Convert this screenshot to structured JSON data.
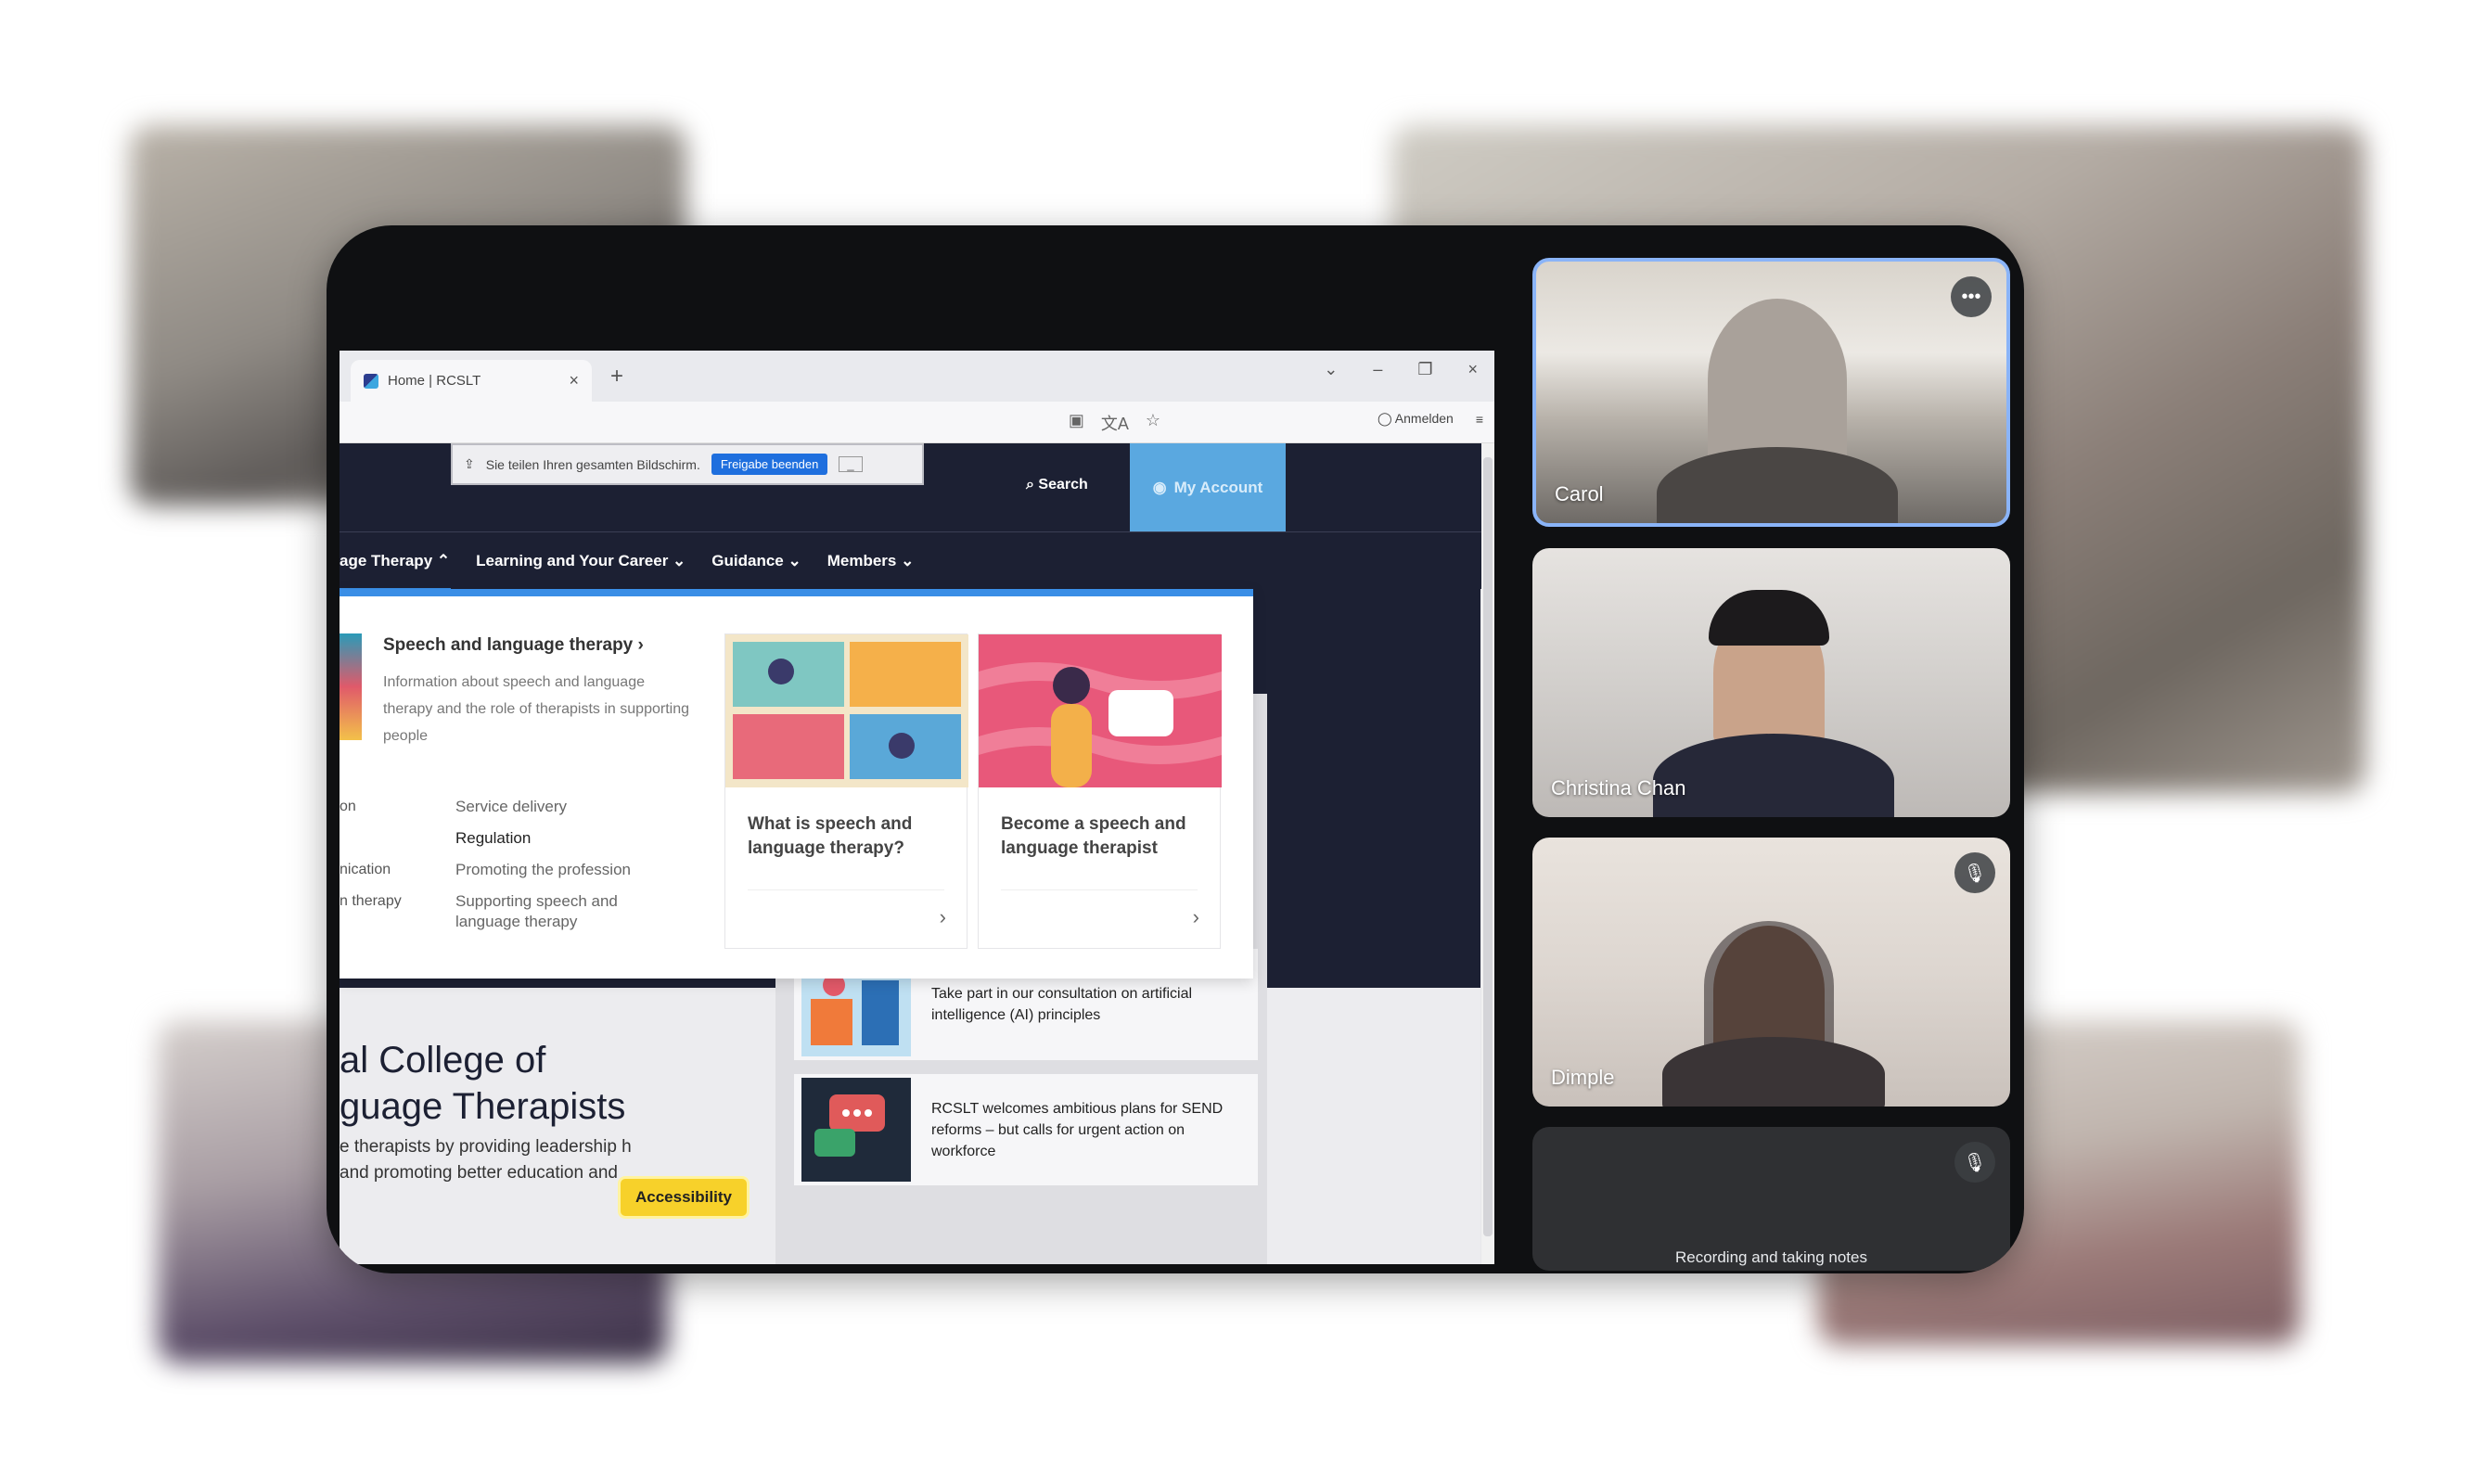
{
  "browser": {
    "tab_title": "Home | RCSLT",
    "tab_close": "×",
    "new_tab": "+",
    "window_controls": [
      "⌄",
      "–",
      "❐",
      "×"
    ],
    "toolbar_icons": [
      "▣",
      "文A",
      "☆"
    ],
    "profile_label": "Anmelden",
    "menu_icon": "≡"
  },
  "share_bar": {
    "message": "Sie teilen Ihren gesamten Bildschirm.",
    "stop_label": "Freigabe beenden",
    "hide_label": "_"
  },
  "site": {
    "search_label": "Search",
    "account_label": "My Account",
    "nav": [
      "age Therapy ⌃",
      "Learning and Your Career ⌄",
      "Guidance ⌄",
      "Members ⌄"
    ],
    "hero_title_1": "al College of",
    "hero_title_2": "guage Therapists",
    "hero_text": "e therapists by providing leadership h and promoting better education and",
    "accessibility_label": "Accessibility"
  },
  "mega_menu": {
    "heading": "Speech and language therapy ›",
    "description": "Information about speech and language therapy and the role of therapists in supporting people",
    "left_partial": [
      "on",
      "",
      "nication",
      "n therapy"
    ],
    "links": [
      "Service delivery",
      "Regulation",
      "Promoting the profession",
      "Supporting speech and language therapy"
    ],
    "cards": [
      {
        "title": "What is speech and language therapy?",
        "chevron": "›"
      },
      {
        "title": "Become a speech and language therapist",
        "chevron": "›"
      }
    ]
  },
  "news": [
    {
      "text": "Take part in our consultation on artificial intelligence (AI) principles"
    },
    {
      "text": "RCSLT welcomes ambitious plans for SEND reforms – but calls for urgent action on workforce"
    }
  ],
  "participants": [
    {
      "name": "Carol",
      "badge": "•••"
    },
    {
      "name": "Christina Chan",
      "badge": ""
    },
    {
      "name": "Dimple",
      "badge": "🎙"
    },
    {
      "name": "",
      "badge": "🎙",
      "status": "Recording and taking notes"
    }
  ]
}
